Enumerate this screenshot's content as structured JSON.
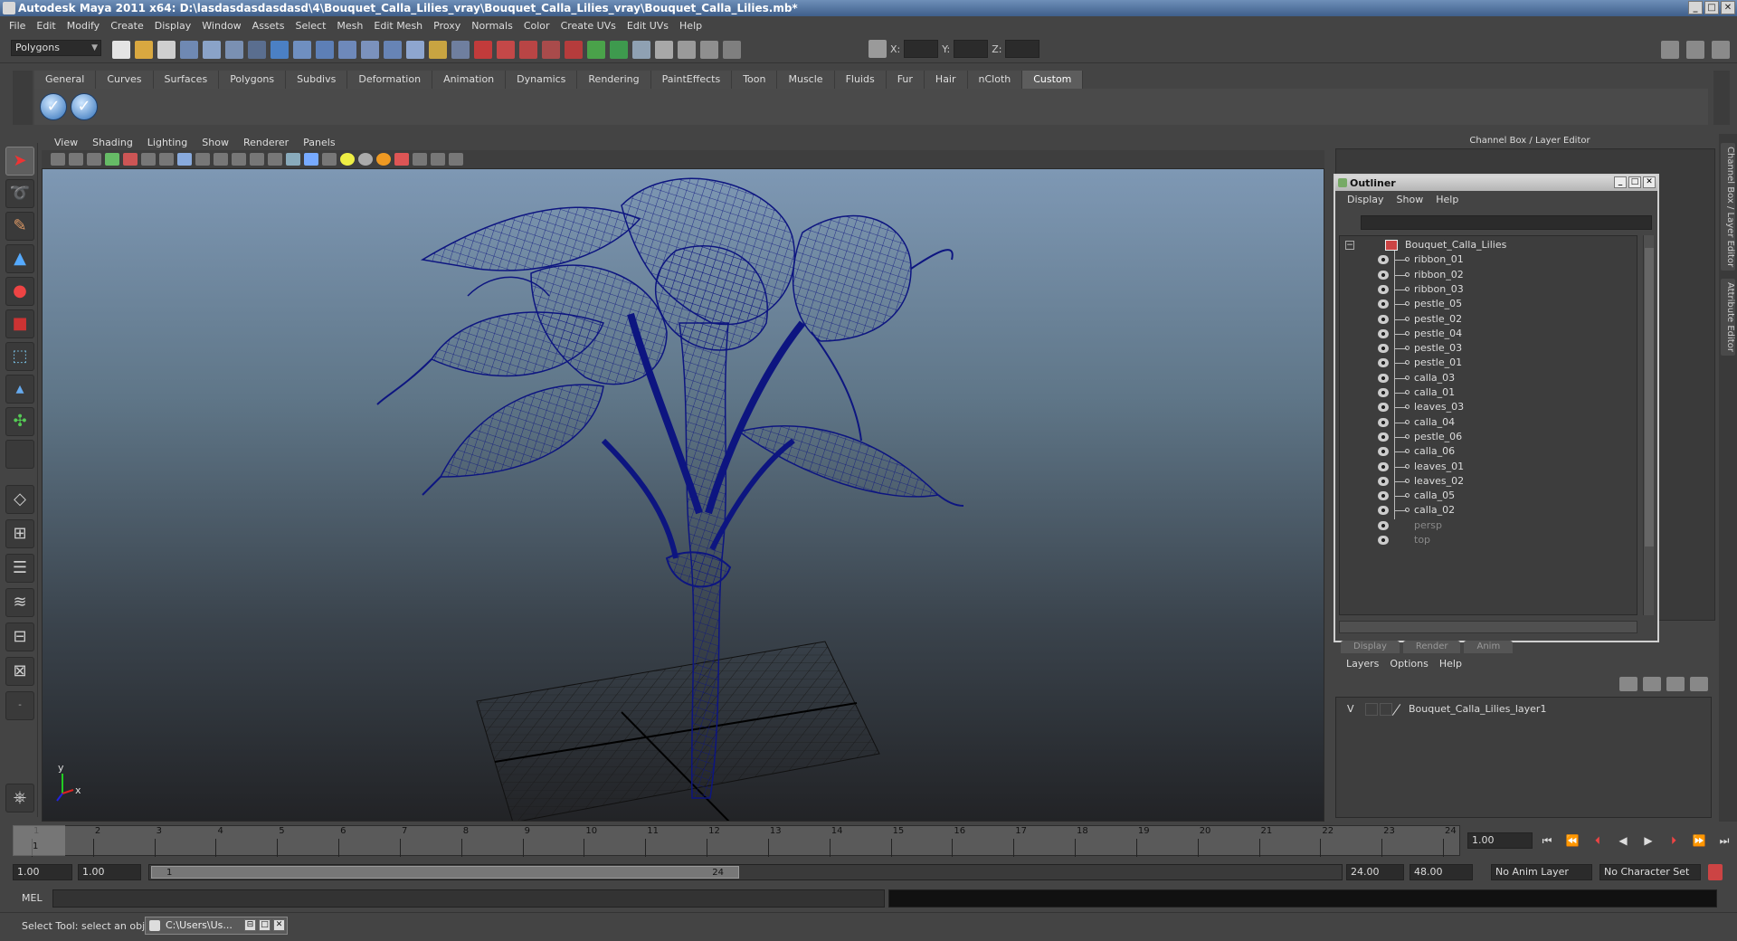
{
  "window": {
    "title": "Autodesk Maya 2011 x64: D:\\lasdasdasdasdasd\\4\\Bouquet_Calla_Lilies_vray\\Bouquet_Calla_Lilies_vray\\Bouquet_Calla_Lilies.mb*",
    "buttons": [
      "_",
      "□",
      "✕"
    ]
  },
  "menubar": [
    "File",
    "Edit",
    "Modify",
    "Create",
    "Display",
    "Window",
    "Assets",
    "Select",
    "Mesh",
    "Edit Mesh",
    "Proxy",
    "Normals",
    "Color",
    "Create UVs",
    "Edit UVs",
    "Help"
  ],
  "statusline": {
    "mode": "Polygons",
    "x_label": "X:",
    "y_label": "Y:",
    "z_label": "Z:"
  },
  "shelf": {
    "tabs": [
      "General",
      "Curves",
      "Surfaces",
      "Polygons",
      "Subdivs",
      "Deformation",
      "Animation",
      "Dynamics",
      "Rendering",
      "PaintEffects",
      "Toon",
      "Muscle",
      "Fluids",
      "Fur",
      "Hair",
      "nCloth",
      "Custom"
    ],
    "active_tab": "Custom",
    "buttons": [
      "checkmark-icon",
      "checkmark-icon"
    ]
  },
  "viewport": {
    "menu": [
      "View",
      "Shading",
      "Lighting",
      "Show",
      "Renderer",
      "Panels"
    ],
    "axis_y": "y",
    "axis_x": "x",
    "wire_color": "#0d1580"
  },
  "channel_box": {
    "title": "Channel Box / Layer Editor",
    "side_tabs": [
      "Channel Box / Layer Editor",
      "Attribute Editor"
    ]
  },
  "outliner": {
    "title": "Outliner",
    "menu": [
      "Display",
      "Show",
      "Help"
    ],
    "root": "Bouquet_Calla_Lilies",
    "items": [
      "ribbon_01",
      "ribbon_02",
      "ribbon_03",
      "pestle_05",
      "pestle_02",
      "pestle_04",
      "pestle_03",
      "pestle_01",
      "calla_03",
      "calla_01",
      "leaves_03",
      "calla_04",
      "pestle_06",
      "calla_06",
      "leaves_01",
      "leaves_02",
      "calla_05",
      "calla_02"
    ],
    "cameras": [
      "persp",
      "top"
    ]
  },
  "layer_editor": {
    "tabs": [
      "Display",
      "Render",
      "Anim"
    ],
    "menu": [
      "Layers",
      "Options",
      "Help"
    ],
    "layer": {
      "visible": "V",
      "name": "Bouquet_Calla_Lilies_layer1"
    }
  },
  "time_slider": {
    "ticks": [
      "1",
      "2",
      "3",
      "4",
      "5",
      "6",
      "7",
      "8",
      "9",
      "10",
      "11",
      "12",
      "13",
      "14",
      "15",
      "16",
      "17",
      "18",
      "19",
      "20",
      "21",
      "22",
      "23",
      "24"
    ],
    "current_frame": "1",
    "current_field": "1.00"
  },
  "range_slider": {
    "start": "1.00",
    "anim_start": "1.00",
    "range_start": "1",
    "range_end": "24",
    "anim_end": "24.00",
    "end": "48.00",
    "anim_layer": "No Anim Layer",
    "character_set": "No Character Set"
  },
  "command_line": {
    "label": "MEL"
  },
  "help_line": {
    "text": "Select Tool: select an object",
    "task": "C:\\Users\\Us..."
  }
}
